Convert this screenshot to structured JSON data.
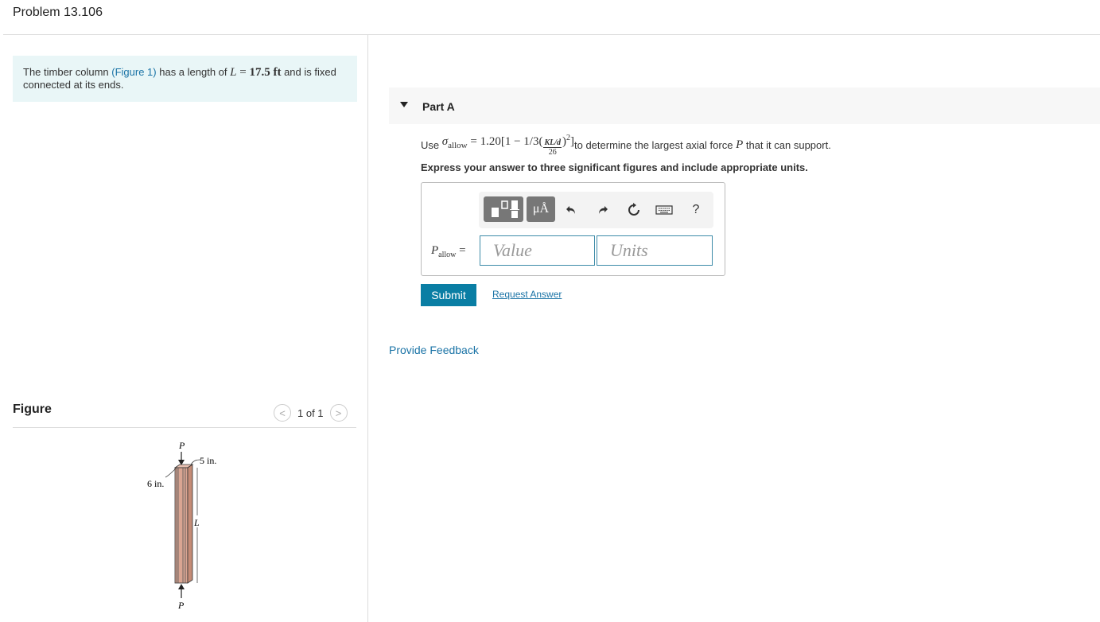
{
  "page": {
    "title": "Problem 13.106"
  },
  "intro": {
    "text_before": "The timber column ",
    "figure_link": "(Figure 1)",
    "text_mid": " has a length of ",
    "length_var": "L",
    "length_eq": " = ",
    "length_value": "17.5",
    "length_unit": " ft",
    "text_after": " and is fixed connected at its ends."
  },
  "figure": {
    "label": "Figure",
    "pager_prev": "<",
    "pager_text": "1 of 1",
    "pager_next": ">",
    "labels": {
      "top_force": "P",
      "bottom_force": "P",
      "depth": "5 in.",
      "width": "6 in.",
      "length": "L"
    },
    "colors": {
      "column_face": "#d9a592",
      "column_side": "#c48b76",
      "stripe": "#555555"
    }
  },
  "part": {
    "label": "Part A",
    "question": {
      "use": "Use ",
      "sigma": "σ",
      "sigma_sub": "allow",
      "eq_lead": " = 1.20[1 − 1/3(",
      "frac_num": "KL/d",
      "frac_den": "26",
      "eq_tail": ")",
      "exp": "2",
      "eq_close": "]",
      "text_mid": " to determine the largest axial force ",
      "force_var": "P",
      "text_end": " that it can support."
    },
    "instruction": "Express your answer to three significant figures and include appropriate units.",
    "toolbar": {
      "units_glyph": "μÅ",
      "undo_icon": "undo-icon",
      "redo_icon": "redo-icon",
      "reset_icon": "reset-icon",
      "keyboard_icon": "keyboard-icon",
      "help": "?"
    },
    "answer": {
      "var": "P",
      "var_sub": "allow",
      "equals": " =",
      "value_placeholder": "Value",
      "units_placeholder": "Units"
    },
    "submit_label": "Submit",
    "request_answer_label": "Request Answer"
  },
  "feedback_label": "Provide Feedback",
  "theme": {
    "accent": "#0a7ea4",
    "link": "#1a73a6",
    "intro_bg": "#e9f6f7"
  }
}
